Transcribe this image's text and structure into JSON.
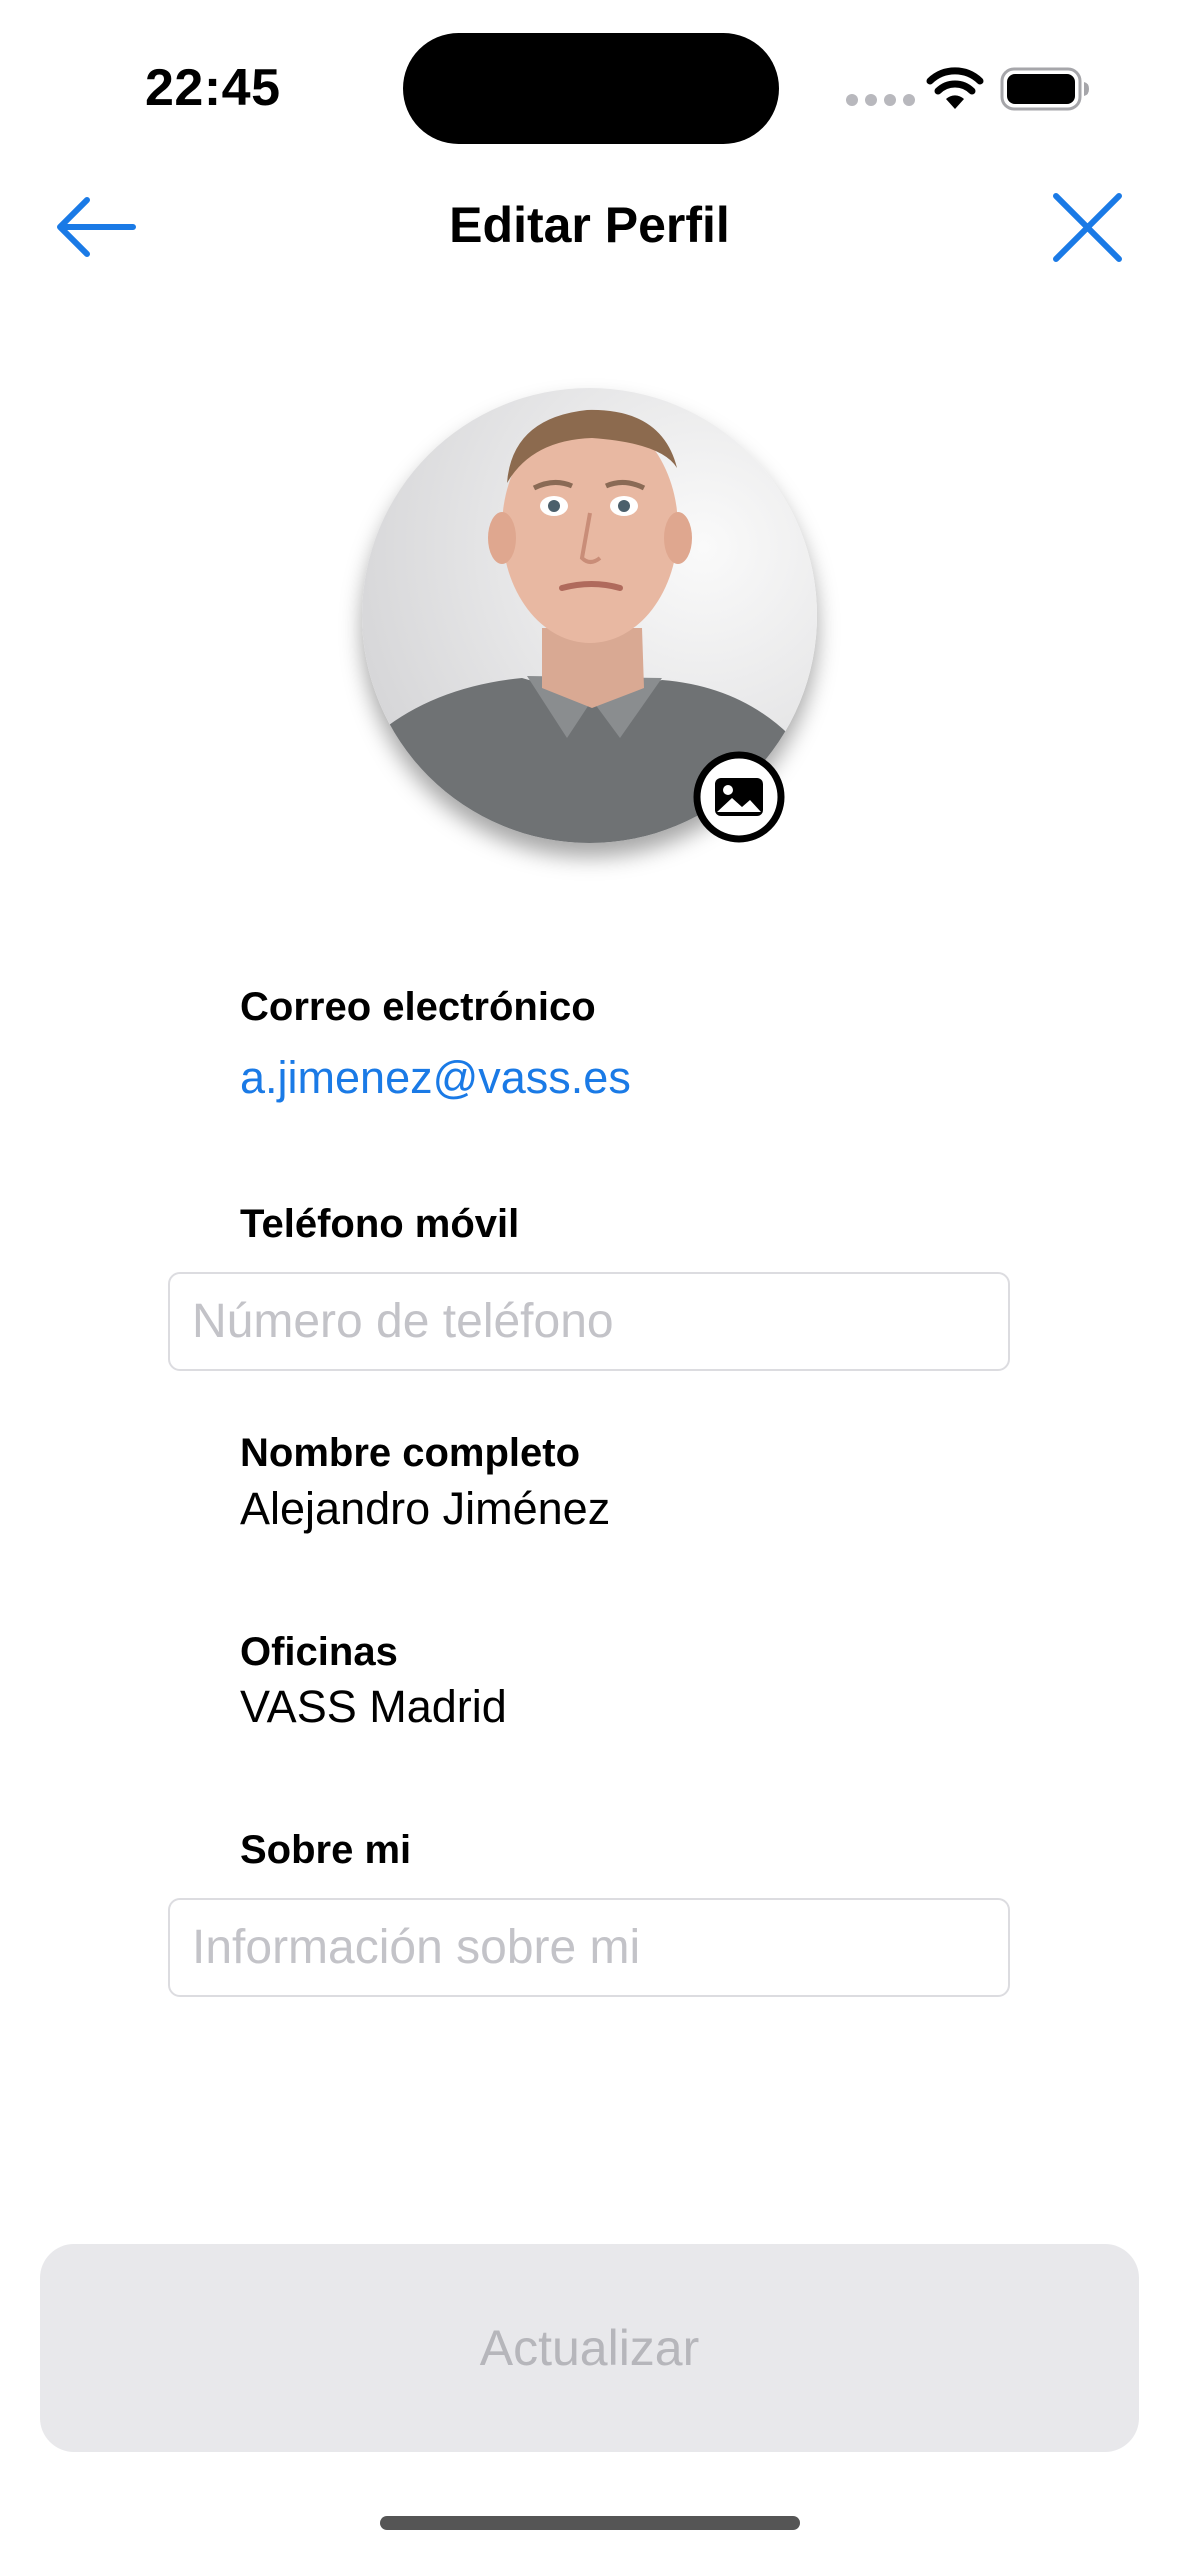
{
  "status_bar": {
    "time": "22:45"
  },
  "nav": {
    "title": "Editar Perfil",
    "back_icon": "arrow-left-icon",
    "close_icon": "close-icon",
    "accent_color": "#1a7ae6"
  },
  "avatar": {
    "badge_icon": "image-icon"
  },
  "fields": {
    "email": {
      "label": "Correo electrónico",
      "value": "a.jimenez@vass.es"
    },
    "phone": {
      "label": "Teléfono móvil",
      "value": "",
      "placeholder": "Número de teléfono"
    },
    "full_name": {
      "label": "Nombre completo",
      "value": "Alejandro Jiménez"
    },
    "office": {
      "label": "Oficinas",
      "value": "VASS Madrid"
    },
    "about": {
      "label": "Sobre mi",
      "value": "",
      "placeholder": "Información sobre mi"
    }
  },
  "actions": {
    "update_label": "Actualizar"
  }
}
